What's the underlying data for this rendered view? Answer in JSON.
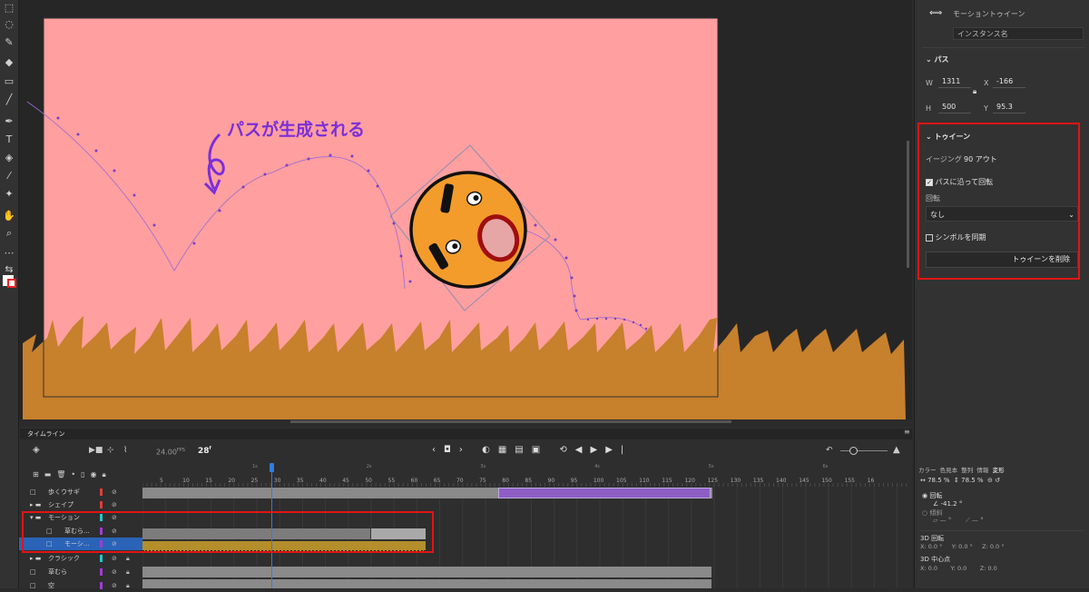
{
  "stage": {
    "annotation": "パスが生成される",
    "colors": {
      "canvas": "#ff9f9f",
      "grass": "#c7802c",
      "path": "#9b6bd6",
      "annotation": "#7a2fd9",
      "face": "#f39c2b"
    }
  },
  "property_panel": {
    "title": "モーショントゥイーン",
    "instance_placeholder": "インスタンス名",
    "path_section": {
      "label": "パス",
      "w_label": "W",
      "w_value": "1311",
      "x_label": "X",
      "x_value": "-166",
      "h_label": "H",
      "h_value": "500",
      "y_label": "Y",
      "y_value": "95.3"
    },
    "tween_section": {
      "label": "トゥイーン",
      "easing_label": "イージング",
      "easing_value": "90 アウト",
      "rotate_along_path_label": "パスに沿って回転",
      "rotate_along_path_checked": true,
      "rotation_label": "回転",
      "rotation_value": "なし",
      "sync_symbol_label": "シンボルを同期",
      "sync_symbol_checked": false,
      "delete_button": "トゥイーンを削除"
    }
  },
  "transform_panel": {
    "tabs": [
      "カラー",
      "色見本",
      "整列",
      "情報",
      "変形"
    ],
    "width_pct": "78.5 %",
    "height_pct": "78.5 %",
    "rotate_label": "回転",
    "rotate_value": "-41.2 °",
    "skew_label": "傾斜",
    "skew_h": "— °",
    "skew_v": "— °",
    "rotation3d_label": "3D 回転",
    "rot3d": {
      "x": "X:",
      "x_val": "0.0 °",
      "y": "Y:",
      "y_val": "0.0 °",
      "z": "Z:",
      "z_val": "0.0 °"
    },
    "center3d_label": "3D 中心点",
    "center3d": {
      "x": "X:",
      "x_val": "0.0",
      "y": "Y:",
      "y_val": "0.0",
      "z": "Z:",
      "z_val": "0.0"
    }
  },
  "timeline": {
    "title": "タイムライン",
    "fps": "24.00",
    "fps_unit": "FPS",
    "current_frame": "28",
    "frame_unit": "f",
    "frame_numbers": [
      "5",
      "10",
      "15",
      "20",
      "25",
      "30",
      "35",
      "40",
      "45",
      "50",
      "55",
      "60",
      "65",
      "70",
      "75",
      "80",
      "85",
      "90",
      "95",
      "100",
      "105",
      "110",
      "115",
      "120",
      "125",
      "130",
      "135",
      "140",
      "145",
      "150",
      "155",
      "16"
    ],
    "seconds": [
      "1s",
      "2s",
      "3s",
      "4s",
      "5s",
      "6s"
    ],
    "layers": [
      {
        "name": "歩くウサギ",
        "color": "#e23b3b",
        "type": "layer"
      },
      {
        "name": "シェイプ",
        "color": "#e23b3b",
        "type": "folder"
      },
      {
        "name": "モーション",
        "color": "#1fc8c8",
        "type": "folder-open"
      },
      {
        "name": "草むら...",
        "color": "#a23bd6",
        "type": "layer"
      },
      {
        "name": "モーシ...",
        "color": "#a23bd6",
        "type": "layer",
        "selected": true
      },
      {
        "name": "クラシック",
        "color": "#1fc8c8",
        "type": "folder"
      },
      {
        "name": "草むら",
        "color": "#a23bd6",
        "type": "layer"
      },
      {
        "name": "空",
        "color": "#a23bd6",
        "type": "layer"
      }
    ]
  }
}
